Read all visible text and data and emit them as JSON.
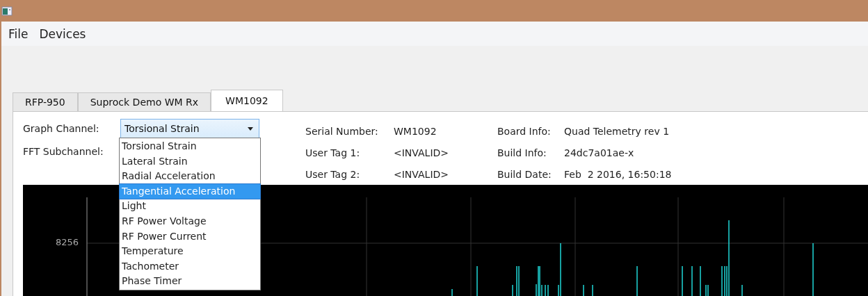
{
  "menu": [
    {
      "label": "File"
    },
    {
      "label": "Devices"
    }
  ],
  "tabs": [
    {
      "label": "RFP-950",
      "selected": false
    },
    {
      "label": "Suprock Demo WM Rx",
      "selected": false
    },
    {
      "label": "WM1092",
      "selected": true
    }
  ],
  "graph_channel": {
    "label": "Graph Channel:",
    "value": "Torsional Strain",
    "expanded": true,
    "options": [
      {
        "label": "Torsional Strain",
        "highlighted": false
      },
      {
        "label": "Lateral Strain",
        "highlighted": false
      },
      {
        "label": "Radial Acceleration",
        "highlighted": false
      },
      {
        "label": "Tangential Acceleration",
        "highlighted": true
      },
      {
        "label": "Light",
        "highlighted": false
      },
      {
        "label": "RF Power Voltage",
        "highlighted": false
      },
      {
        "label": "RF Power Current",
        "highlighted": false
      },
      {
        "label": "Temperature",
        "highlighted": false
      },
      {
        "label": "Tachometer",
        "highlighted": false
      },
      {
        "label": "Phase Timer",
        "highlighted": false
      }
    ]
  },
  "fft_subchannel": {
    "label": "FFT Subchannel:"
  },
  "info_columns": [
    [
      {
        "label": "Serial Number:",
        "value": "WM1092"
      },
      {
        "label": "User Tag 1:",
        "value": "<INVALID>"
      },
      {
        "label": "User Tag 2:",
        "value": "<INVALID>"
      }
    ],
    [
      {
        "label": "Board Info:",
        "value": "Quad Telemetry rev 1"
      },
      {
        "label": "Build Info:",
        "value": "24dc7a01ae-x"
      },
      {
        "label": "Build Date:",
        "value": "Feb  2 2016, 16:50:18"
      }
    ]
  ],
  "chart": {
    "y_tick_label": "8256"
  }
}
